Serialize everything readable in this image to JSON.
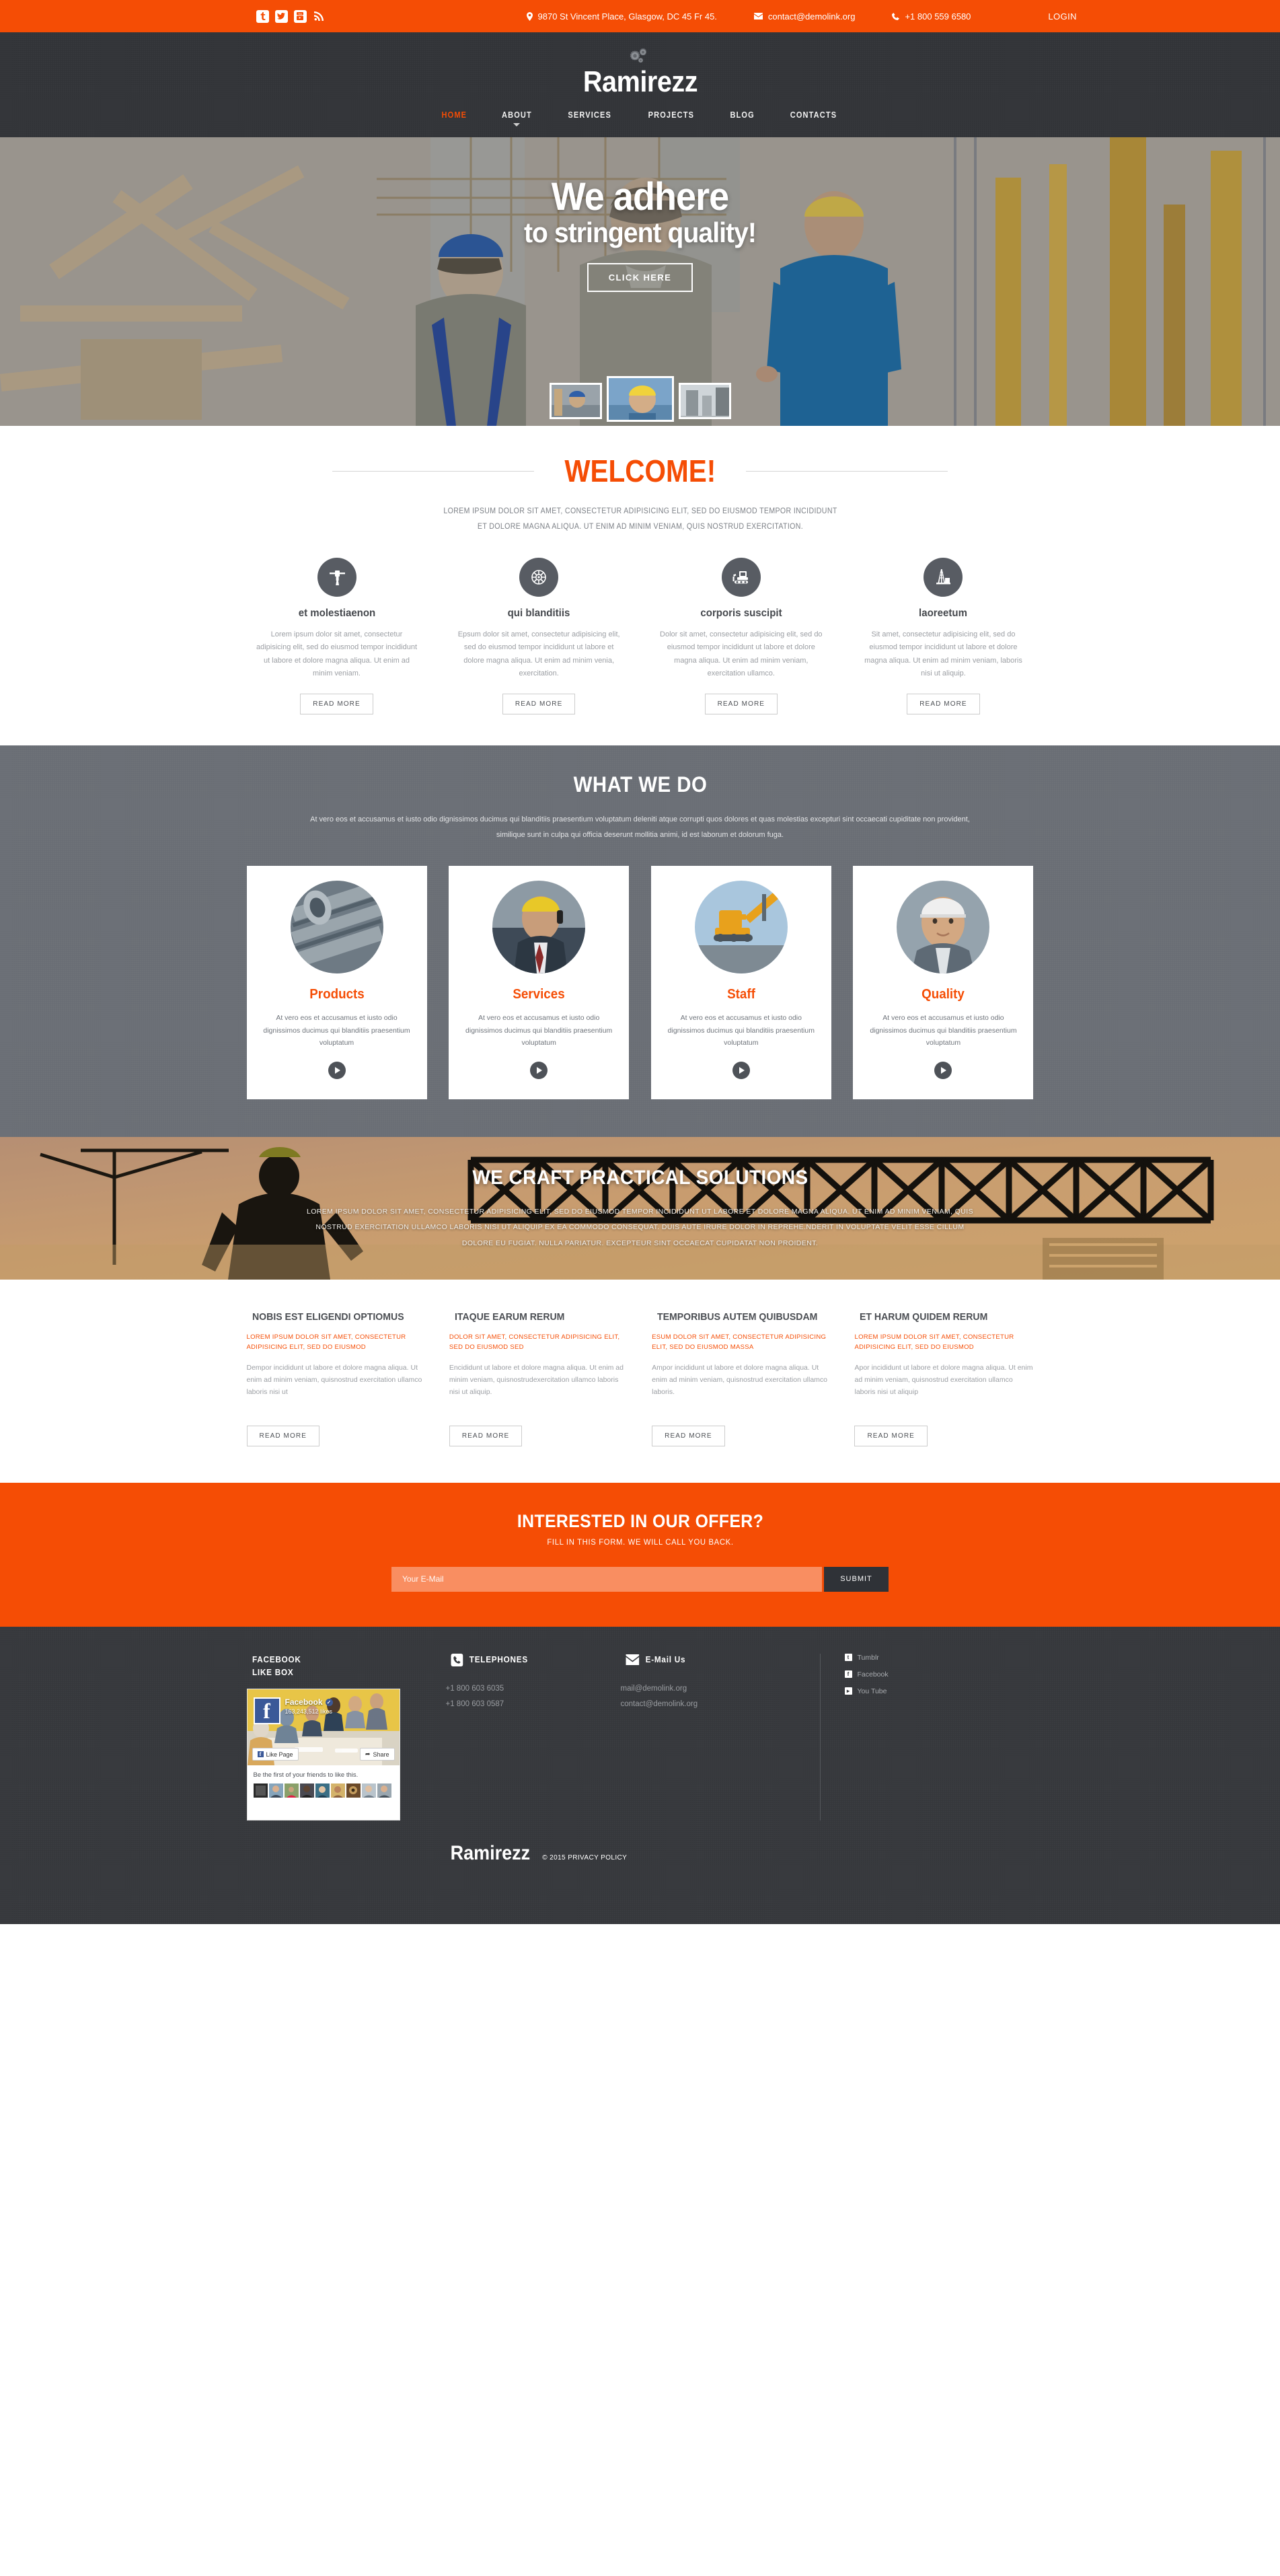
{
  "topbar": {
    "social": [
      {
        "name": "tumblr",
        "label": "t"
      },
      {
        "name": "twitter",
        "label": "Twitter"
      },
      {
        "name": "youtube",
        "label": "You Tube"
      },
      {
        "name": "rss",
        "label": "RSS"
      }
    ],
    "address": "9870 St Vincent Place, Glasgow, DC 45 Fr 45.",
    "email": "contact@demolink.org",
    "phone": "+1 800 559 6580",
    "login": "LOGIN",
    "accent": "#f54d05"
  },
  "header": {
    "logo": "Ramirezz",
    "nav": [
      {
        "label": "HOME",
        "active": true,
        "dropdown": false
      },
      {
        "label": "ABOUT",
        "active": false,
        "dropdown": true
      },
      {
        "label": "SERVICES",
        "active": false,
        "dropdown": false
      },
      {
        "label": "PROJECTS",
        "active": false,
        "dropdown": false
      },
      {
        "label": "BLOG",
        "active": false,
        "dropdown": false
      },
      {
        "label": "CONTACTS",
        "active": false,
        "dropdown": false
      }
    ]
  },
  "hero": {
    "line1": "We adhere",
    "line2": "to stringent quality!",
    "button": "CLICK HERE",
    "thumbs": [
      "slide-1",
      "slide-2",
      "slide-3"
    ]
  },
  "welcome": {
    "title": "WELCOME!",
    "subtitle": "LOREM IPSUM DOLOR SIT AMET, CONSECTETUR ADIPISICING ELIT, SED DO EIUSMOD TEMPOR INCIDIDUNT ET DOLORE MAGNA ALIQUA. UT ENIM AD MINIM VENIAM, QUIS NOSTRUD EXERCITATION.",
    "features": [
      {
        "icon": "jackhammer-icon",
        "title": "et molestiaenon",
        "text": "Lorem ipsum dolor sit amet, consectetur adipisicing elit, sed do eiusmod tempor incididunt ut labore et dolore magna aliqua. Ut enim ad minim veniam.",
        "button": "READ MORE"
      },
      {
        "icon": "ship-wheel-icon",
        "title": "qui blanditiis",
        "text": "Epsum dolor sit amet, consectetur adipisicing elit, sed do eiusmod tempor incididunt ut labore et dolore magna aliqua. Ut enim ad minim venia, exercitation.",
        "button": "READ MORE"
      },
      {
        "icon": "bulldozer-icon",
        "title": "corporis suscipit",
        "text": "Dolor sit amet, consectetur adipisicing elit, sed do eiusmod tempor incididunt ut labore et dolore magna aliqua. Ut enim ad minim veniam, exercitation ullamco.",
        "button": "READ MORE"
      },
      {
        "icon": "oil-rig-icon",
        "title": "laoreetum",
        "text": "Sit amet, consectetur adipisicing elit, sed do eiusmod tempor incididunt ut labore et dolore magna aliqua. Ut enim ad minim veniam, laboris nisi ut aliquip.",
        "button": "READ MORE"
      }
    ]
  },
  "what_we_do": {
    "title": "WHAT WE DO",
    "subtitle": "At vero eos et accusamus et iusto odio dignissimos ducimus qui blanditiis praesentium voluptatum deleniti atque corrupti quos dolores et quas molestias excepturi sint occaecati cupiditate non provident, similique sunt in culpa qui officia deserunt mollitia animi, id est laborum et dolorum fuga.",
    "cards": [
      {
        "photo": "pipes-photo",
        "title": "Products",
        "text": "At vero eos et accusamus et iusto odio dignissimos ducimus qui blanditiis praesentium voluptatum"
      },
      {
        "photo": "worker-phone-photo",
        "title": "Services",
        "text": "At vero eos et accusamus et iusto odio dignissimos ducimus qui blanditiis praesentium voluptatum"
      },
      {
        "photo": "crane-photo",
        "title": "Staff",
        "text": "At vero eos et accusamus et iusto odio dignissimos ducimus qui blanditiis praesentium voluptatum"
      },
      {
        "photo": "engineer-photo",
        "title": "Quality",
        "text": "At vero eos et accusamus et iusto odio dignissimos ducimus qui blanditiis praesentium voluptatum"
      }
    ]
  },
  "craft": {
    "title": "WE CRAFT PRACTICAL SOLUTIONS",
    "text": "LOREM IPSUM DOLOR SIT AMET, CONSECTETUR ADIPISICING ELIT, SED DO EIUSMOD TEMPOR INCIDIDUNT UT LABORE ET DOLORE MAGNA ALIQUA. UT ENIM AD MINIM VENIAM, QUIS NOSTRUD EXERCITATION ULLAMCO LABORIS NISI UT ALIQUIP EX EA COMMODO CONSEQUAT. DUIS AUTE IRURE DOLOR IN REPREHE.NDERIT IN VOLUPTATE VELIT ESSE CILLUM DOLORE EU FUGIAT. NULLA PARIATUR. EXCEPTEUR SINT OCCAECAT CUPIDATAT NON PROIDENT."
  },
  "news": [
    {
      "title": "NOBIS EST ELIGENDI OPTIOMUS",
      "subtitle": "LOREM IPSUM DOLOR SIT AMET, CONSECTETUR ADIPISICING ELIT, SED DO EIUSMOD",
      "text": "Dempor incididunt ut labore et dolore magna aliqua. Ut enim ad minim veniam, quisnostrud exercitation ullamco laboris nisi ut",
      "button": "READ MORE"
    },
    {
      "title": "ITAQUE EARUM RERUM",
      "subtitle": "DOLOR SIT AMET, CONSECTETUR ADIPISICING ELIT, SED DO EIUSMOD SED",
      "text": "Encididunt ut labore et dolore magna aliqua. Ut enim ad minim veniam, quisnostrudexercitation ullamco laboris nisi ut aliquip.",
      "button": "READ MORE"
    },
    {
      "title": "TEMPORIBUS AUTEM QUIBUSDAM",
      "subtitle": "ESUM DOLOR SIT AMET, CONSECTETUR ADIPISICING ELIT, SED DO EIUSMOD MASSA",
      "text": "Ampor incididunt ut labore et dolore magna aliqua. Ut enim ad minim veniam, quisnostrud exercitation ullamco laboris.",
      "button": "READ MORE"
    },
    {
      "title": "ET HARUM QUIDEM RERUM",
      "subtitle": "LOREM IPSUM DOLOR SIT AMET, CONSECTETUR ADIPISICING ELIT, SED DO EIUSMOD",
      "text": "Apor incididunt ut labore et dolore magna aliqua. Ut enim ad minim veniam, quisnostrud exercitation ullamco laboris nisi ut aliquip",
      "button": "READ MORE"
    }
  ],
  "cta": {
    "title": "INTERESTED IN OUR OFFER?",
    "subtitle": "FILL IN THIS FORM. WE WILL CALL YOU BACK.",
    "placeholder": "Your E-Mail",
    "value": "",
    "submit": "SUBMIT"
  },
  "footer": {
    "facebook_head_line1": "FACEBOOK",
    "facebook_head_line2": "LIKE BOX",
    "fb_page_name": "Facebook",
    "fb_likes": "163,243,512 likes",
    "fb_like_btn": "Like Page",
    "fb_share_btn": "Share",
    "fb_body_text": "Be the first of your friends to like this.",
    "telephones_head": "TELEPHONES",
    "telephones": [
      "+1 800 603 6035",
      "+1 800 603 0587"
    ],
    "email_head": "E-Mail Us",
    "emails": [
      "mail@demolink.org",
      "contact@demolink.org"
    ],
    "social": [
      {
        "name": "tumblr",
        "label": "Tumblr",
        "glyph": "t"
      },
      {
        "name": "facebook",
        "label": "Facebook",
        "glyph": "f"
      },
      {
        "name": "youtube",
        "label": "You Tube",
        "glyph": "Y"
      }
    ],
    "logo": "Ramirezz",
    "copyright": "© 2015 PRIVACY POLICY"
  }
}
